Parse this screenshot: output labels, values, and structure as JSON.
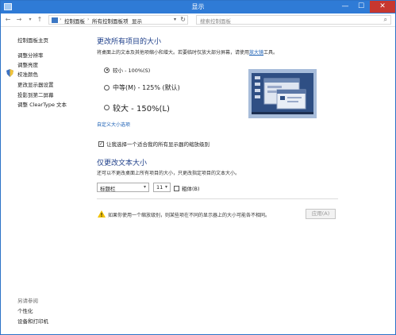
{
  "window": {
    "title": "显示",
    "minimize": "—",
    "maximize": "☐",
    "close": "✕"
  },
  "address": {
    "back": "←",
    "forward": "→",
    "up": "↑",
    "crumbs": [
      "控制面板",
      "所有控制面板项",
      "显示"
    ],
    "separator": "›",
    "search_placeholder": "搜索控制面板"
  },
  "sidebar": {
    "home": "控制面板主页",
    "items": [
      "调整分辨率",
      "调整亮度",
      "校准颜色",
      "更改显示器设置",
      "投影到第二屏幕",
      "调整 ClearType 文本"
    ],
    "see_also_title": "另请参阅",
    "see_also": [
      "个性化",
      "设备和打印机"
    ]
  },
  "main": {
    "size_title": "更改所有项目的大小",
    "size_desc_pre": "将桌面上的文本及其他项缩小和增大。若要临时仅放大部分屏幕，请使用",
    "size_desc_link": "放大镜",
    "size_desc_post": "工具。",
    "options": [
      {
        "label": "较小 - 100%(S)",
        "selected": true
      },
      {
        "label": "中等(M) - 125% (默认)",
        "selected": false
      },
      {
        "label": "较大 - 150%(L)",
        "selected": false
      }
    ],
    "custom_link": "自定义大小选项",
    "scale_checkbox": "让我选择一个适合我的所有显示器的缩放级别",
    "scale_checked": true,
    "text_title": "仅更改文本大小",
    "text_desc": "还可以不更改桌面上所有项目的大小，只更改指定项目的文本大小。",
    "element_select": "标题栏",
    "size_select": "11",
    "bold_label": "粗体(B)",
    "bold_checked": false,
    "warning": "如果你使用一个缩放级别，则某些项在不同的显示器上的大小可能各不相同。",
    "apply_label": "应用(A)"
  }
}
